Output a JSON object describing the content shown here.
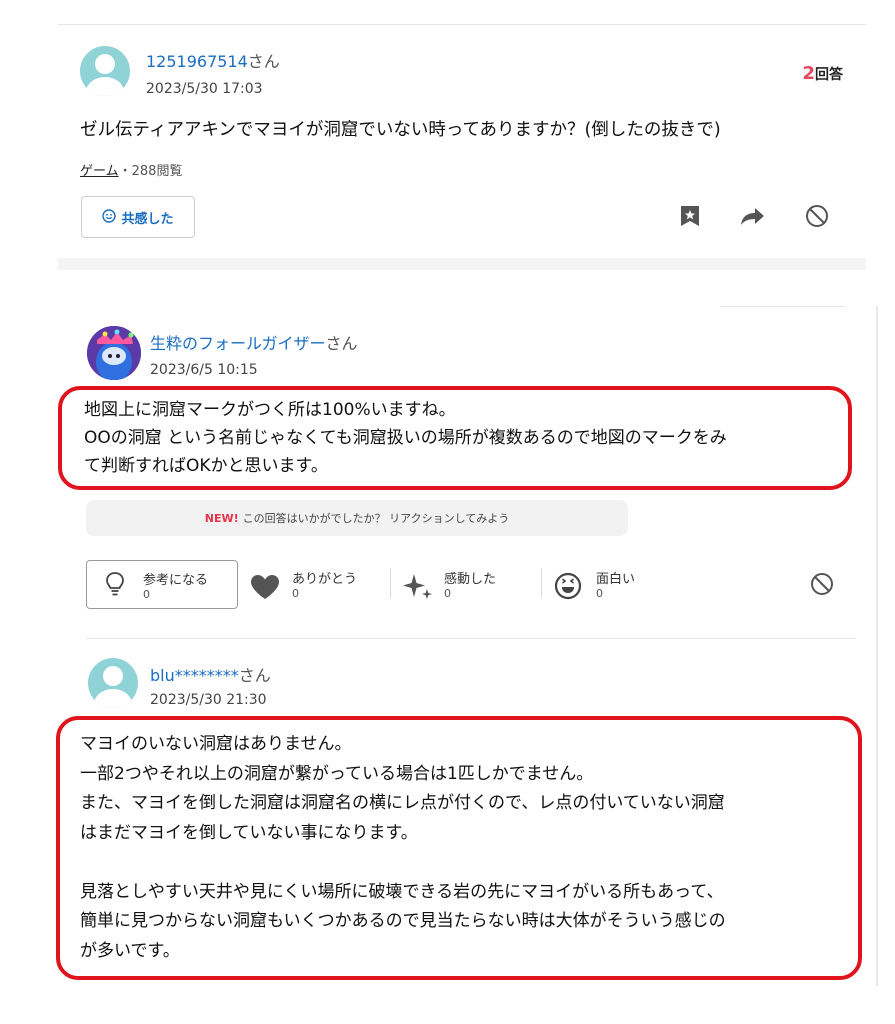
{
  "question": {
    "user_name": "1251967514",
    "user_suffix": "さん",
    "date": "2023/5/30 17:03",
    "answer_count_number": "2",
    "answer_count_unit": "回答",
    "text": "ゼル伝ティアアキンでマヨイが洞窟でいない時ってありますか？(倒したの抜きで)",
    "category": "ゲーム",
    "views": "・288閲覧",
    "empathy_label": "共感した"
  },
  "answer1": {
    "user_name": "生粋のフォールガイザー",
    "user_suffix": "さん",
    "date": "2023/6/5 10:15",
    "lines": [
      "地図上に洞窟マークがつく所は100%いますね。",
      "OOの洞窟 という名前じゃなくても洞窟扱いの場所が複数あるので地図のマークをみ",
      "て判断すればOKかと思います。"
    ],
    "prompt_new": "NEW!",
    "prompt_text": "この回答はいかがでしたか？ リアクションしてみよう",
    "reactions": [
      {
        "label": "参考になる",
        "count": "0"
      },
      {
        "label": "ありがとう",
        "count": "0"
      },
      {
        "label": "感動した",
        "count": "0"
      },
      {
        "label": "面白い",
        "count": "0"
      }
    ]
  },
  "answer2": {
    "user_name": "blu********",
    "user_suffix": "さん",
    "date": "2023/5/30 21:30",
    "lines": [
      "マヨイのいない洞窟はありません。",
      "一部2つやそれ以上の洞窟が繋がっている場合は1匹しかでません。",
      "また、マヨイを倒した洞窟は洞窟名の横にレ点が付くので、レ点の付いていない洞窟",
      "はまだマヨイを倒していない事になります。",
      "",
      "見落としやすい天井や見にくい場所に破壊できる岩の先にマヨイがいる所もあって、",
      "簡単に見つからない洞窟もいくつかあるので見当たらない時は大体がそういう感じの",
      "が多いです。"
    ]
  },
  "colors": {
    "accent_blue": "#1a6ec2",
    "answer_count_red": "#e8475a",
    "highlight_red": "#e0141e",
    "new_badge_red": "#e8334a"
  }
}
